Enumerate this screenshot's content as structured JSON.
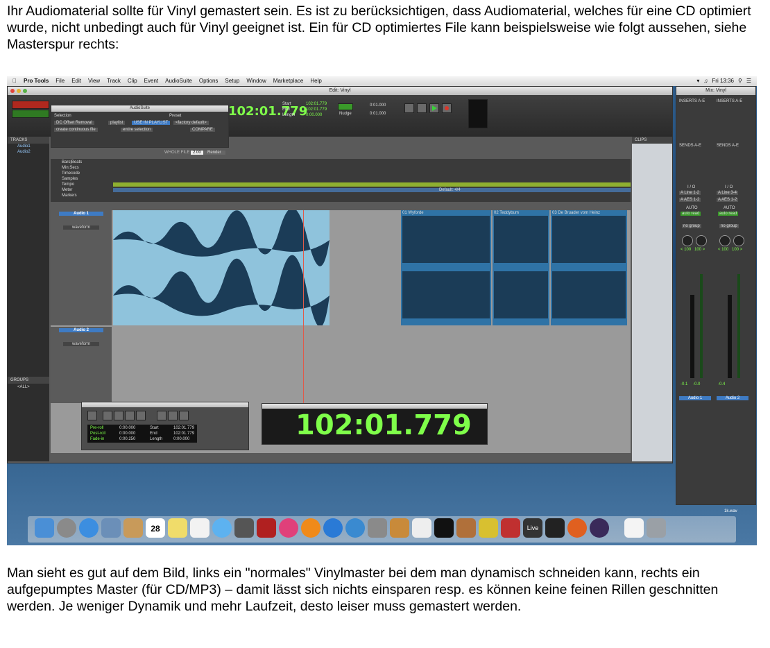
{
  "text": {
    "para1": "Ihr Audiomaterial sollte für Vinyl gemastert sein. Es ist zu berücksichtigen, dass Audiomaterial, welches für eine CD optimiert wurde, nicht unbedingt auch für Vinyl geeignet ist. Ein für CD optimiertes File kann beispielsweise wie folgt aussehen, siehe Masterspur rechts:",
    "para2": "Man sieht es gut auf dem Bild, links ein \"normales\" Vinylmaster bei dem man dynamisch schneiden kann, rechts ein aufgepumptes Master (für CD/MP3) – damit lässt sich nichts einsparen resp. es können keine feinen Rillen geschnitten werden. Je weniger Dynamik und mehr Laufzeit, desto leiser muss gemastert werden."
  },
  "menubar": {
    "app": "Pro Tools",
    "items": [
      "File",
      "Edit",
      "View",
      "Track",
      "Clip",
      "Event",
      "AudioSuite",
      "Options",
      "Setup",
      "Window",
      "Marketplace",
      "Help"
    ],
    "clock": "Fri 13:36"
  },
  "edit_window": {
    "title": "Edit: Vinyl",
    "main_counter": "102:01.779",
    "start": "102:01.779",
    "end": "102:01.779",
    "length": "0:00.000",
    "grid": "0:01.000",
    "nudge": "0:01.000",
    "tracks_label": "TRACKS",
    "groups_label": "GROUPS",
    "groups_item": "<ALL>",
    "clips_label": "CLIPS",
    "track_list": [
      "Audio1",
      "Audio2"
    ],
    "ruler_rows": [
      "Bars|Beats",
      "Min:Secs",
      "Timecode",
      "Samples",
      "Tempo",
      "Meter",
      "Markers"
    ],
    "meter_label": "Default: 4/4",
    "track1_name": "Audio 1",
    "track2_name": "Audio 2",
    "view_mode": "waveform",
    "clip_names": [
      "01 Wyforde",
      "02 Teddybum",
      "03 De Bruader vom Heinz"
    ]
  },
  "audiosuite": {
    "title": "AudioSuite",
    "selection_label": "Selection",
    "preset_label": "Preset",
    "plugin": "DC Offset Removal",
    "playlist": "playlist",
    "use_in_playlist": "USE IN PLAYLIST",
    "factory_default": "<factory default>",
    "mode": "create continuous file",
    "range": "entire selection",
    "compare": "COMPARE",
    "whole_file_label": "WHOLE FILE",
    "whole_file_value": "2.00",
    "render": "Render"
  },
  "transport": {
    "preroll_label": "Pre-roll",
    "postroll_label": "Post-roll",
    "fadein_label": "Fade-in",
    "preroll": "0:00.000",
    "postroll": "0:00.000",
    "fadein": "0:00.250",
    "start_label": "Start",
    "end_label": "End",
    "length_label": "Length",
    "start": "102:01.779",
    "end": "102:01.779",
    "length": "0:00.000"
  },
  "big_counter": "102:01.779",
  "mix_window": {
    "title": "Mix: Vinyl",
    "inserts": "INSERTS A-E",
    "sends": "SENDS A-E",
    "io": "I / O",
    "input1": "A Line 1-2",
    "input2": "A Line 3-4",
    "output": "A AES 1-2",
    "auto": "AUTO",
    "auto_mode": "auto read",
    "group": "no group",
    "pan_l": "< 100",
    "pan_r": "100 >",
    "vol1": "-0.1",
    "vol1b": "-0.0",
    "vol2": "-0.4",
    "ch1": "Audio 1",
    "ch2": "Audio 2"
  },
  "desktop_file": "1k.wav",
  "dock": {
    "calendar_day": "28",
    "live_label": "Live"
  },
  "colors": {
    "counter": "#7fff4a",
    "clip_bg": "#8fc3dc",
    "clip_bg_dark": "#2f73a6",
    "wave": "#1b3c57",
    "track_name_bg": "#3e7bc4"
  }
}
